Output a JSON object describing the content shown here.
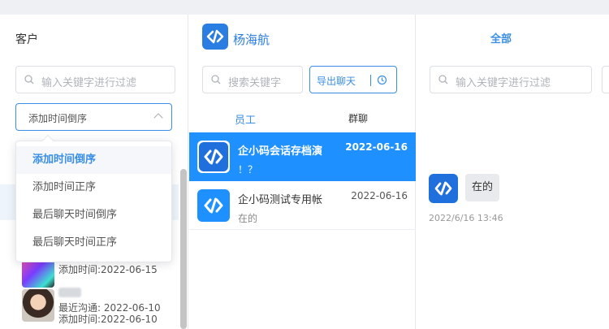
{
  "customers": {
    "title": "客户",
    "filter_placeholder": "输入关键字进行过滤",
    "sort_selected": "添加时间倒序",
    "sort_options": [
      "添加时间倒序",
      "添加时间正序",
      "最后聊天时间倒序",
      "最后聊天时间正序"
    ],
    "items": [
      {
        "add_time": "添加时间:2022-06-15"
      },
      {
        "last_contact": "最近沟通: 2022-06-10",
        "add_time": "添加时间:2022-06-10"
      }
    ]
  },
  "employee": {
    "name": "杨海航",
    "search_placeholder": "搜索关键字",
    "export_label": "导出聊天",
    "tabs": [
      "员工",
      "群聊"
    ],
    "conversations": [
      {
        "name": "企小码会话存档演",
        "date": "2022-06-16",
        "preview": "！？"
      },
      {
        "name": "企小码测试专用帐",
        "date": "2022-06-16",
        "preview": "在的"
      }
    ]
  },
  "chat": {
    "filter_label": "全部",
    "filter_placeholder": "输入关键字进行过滤",
    "message_text": "在的",
    "message_time": "2022/6/16 13:46"
  },
  "colors": {
    "accent": "#3a8ee6",
    "selected_row": "#1e90ff",
    "brand": "#2a7de1"
  }
}
